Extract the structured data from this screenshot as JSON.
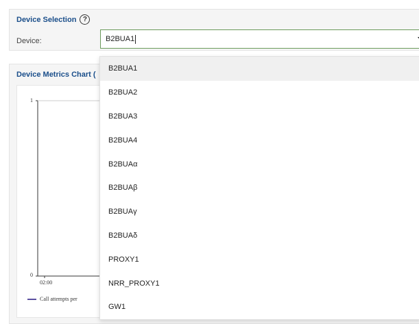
{
  "device_selection": {
    "title": "Device Selection",
    "help_glyph": "?",
    "device_label": "Device:",
    "device_value": "B2BUA1"
  },
  "metrics_chart": {
    "title": "Device Metrics Chart (",
    "y_ticks": [
      "1",
      "0"
    ],
    "x_ticks": [
      "02:00"
    ],
    "legend_label": "Call attempts per"
  },
  "dropdown": {
    "options": [
      {
        "label": "B2BUA1",
        "active": true
      },
      {
        "label": "B2BUA2"
      },
      {
        "label": "B2BUA3"
      },
      {
        "label": "B2BUA4"
      },
      {
        "label": "B2BUAα"
      },
      {
        "label": "B2BUAβ"
      },
      {
        "label": "B2BUAγ"
      },
      {
        "label": "B2BUAδ"
      },
      {
        "label": "PROXY1"
      },
      {
        "label": "NRR_PROXY1"
      },
      {
        "label": "GW1"
      }
    ]
  },
  "colors": {
    "title_blue": "#1a4e8a",
    "input_border": "#6a9a5a",
    "legend_series": "#5b4fa0"
  }
}
